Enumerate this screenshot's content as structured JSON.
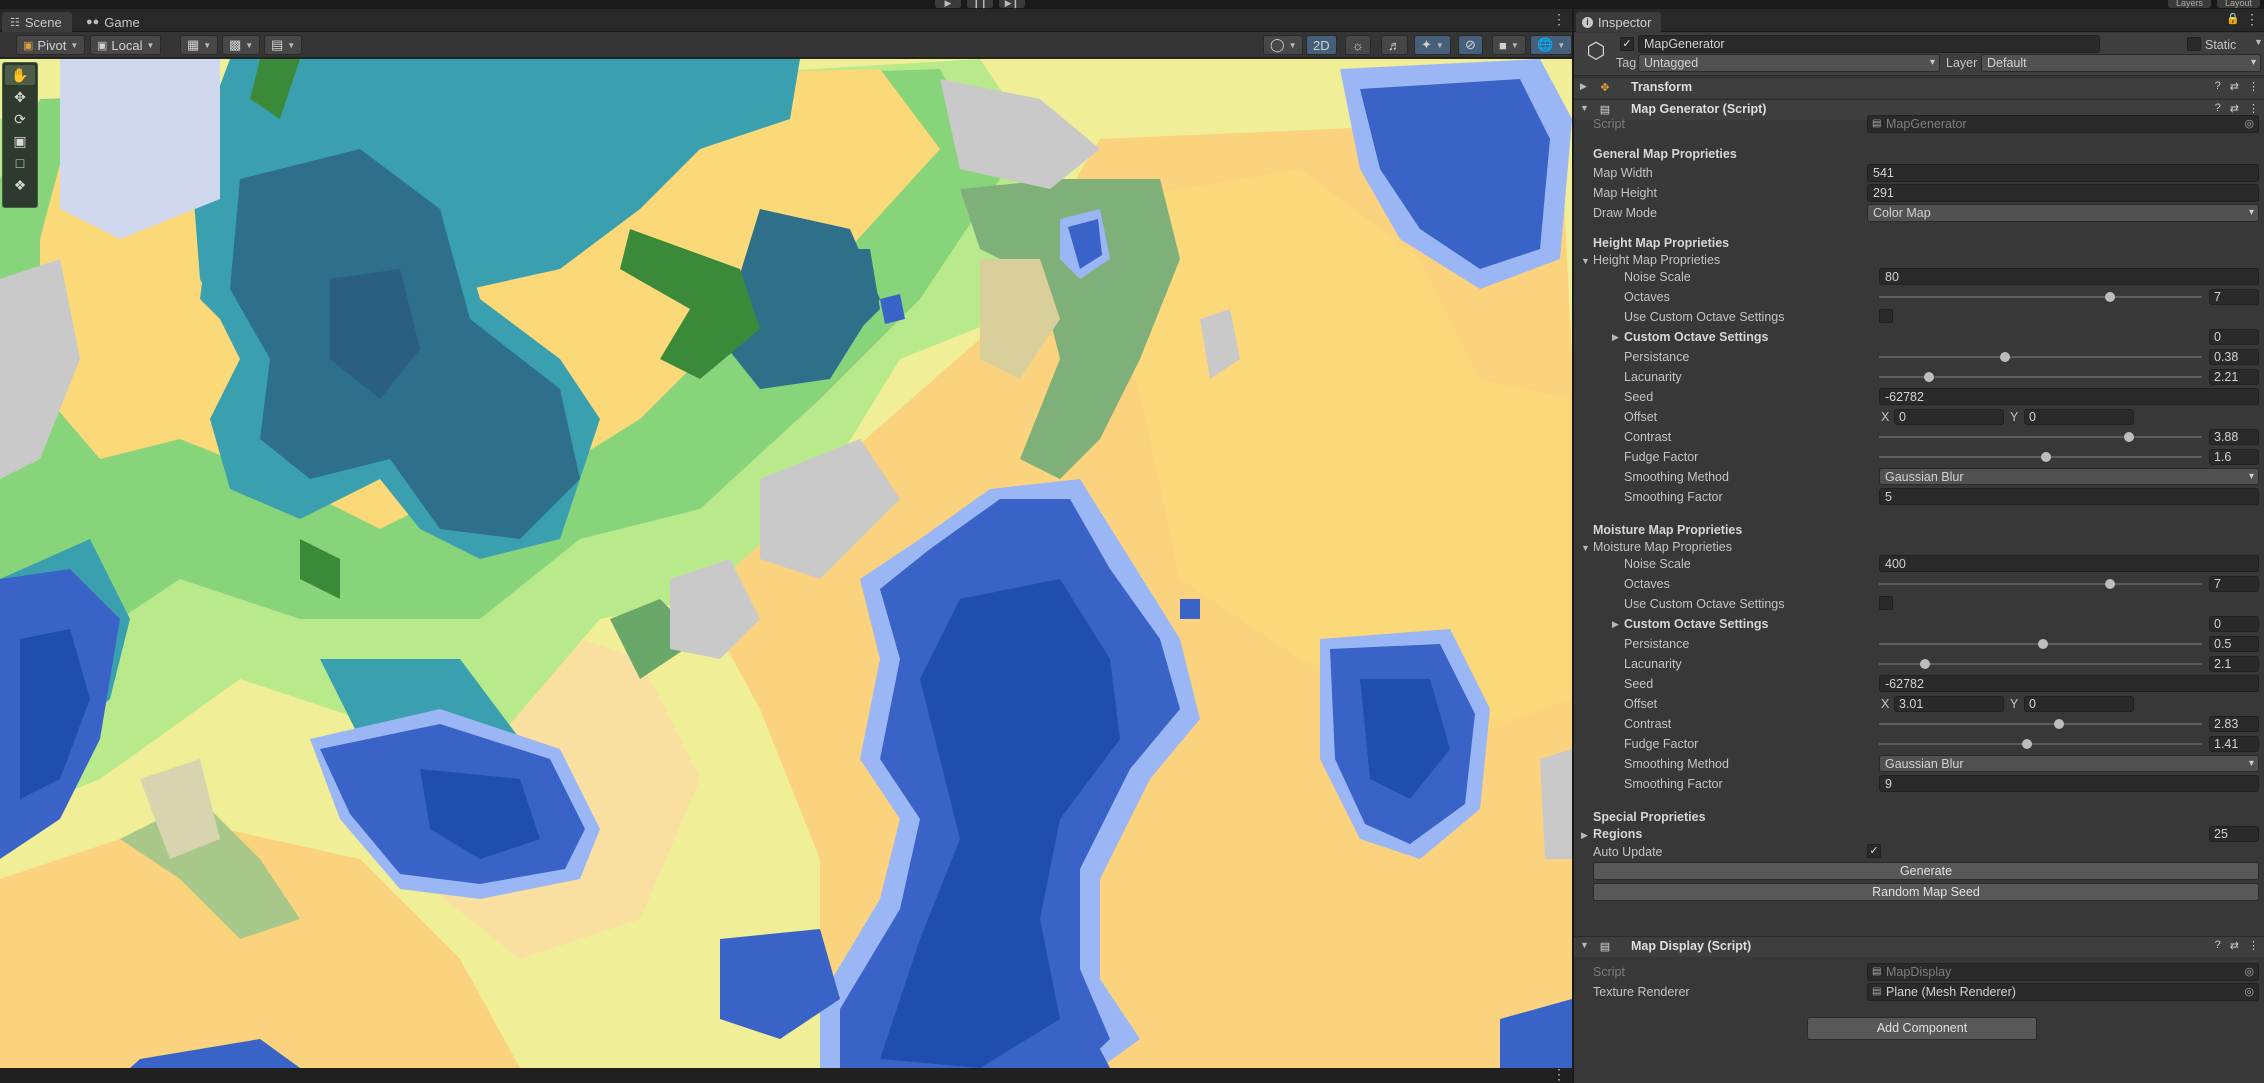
{
  "toolbar": {
    "play_buttons": [
      "▶",
      "❙❙",
      "▶❙"
    ],
    "layers_label": "Layers",
    "layout_label": "Layout"
  },
  "scene": {
    "tabs": [
      {
        "label": "Scene",
        "icon": "grid-icon",
        "active": true
      },
      {
        "label": "Game",
        "icon": "gamepad-icon",
        "active": false
      }
    ],
    "pivot_label": "Pivot",
    "local_label": "Local",
    "mode_2d_label": "2D",
    "tools": [
      "hand-tool",
      "move-tool",
      "rotate-tool",
      "scale-tool",
      "rect-tool",
      "transform-tool"
    ]
  },
  "inspector": {
    "tab_label": "Inspector",
    "object_name": "MapGenerator",
    "active": true,
    "static_label": "Static",
    "tag_label": "Tag",
    "tag_value": "Untagged",
    "layer_label": "Layer",
    "layer_value": "Default",
    "transform_title": "Transform",
    "map_generator": {
      "title": "Map Generator (Script)",
      "script_label": "Script",
      "script_value": "MapGenerator",
      "general_header": "General Map Proprieties",
      "map_width_label": "Map Width",
      "map_width": "541",
      "map_height_label": "Map Height",
      "map_height": "291",
      "draw_mode_label": "Draw Mode",
      "draw_mode": "Color Map",
      "height_header": "Height Map Proprieties",
      "height_fold": "Height Map Proprieties",
      "height": {
        "noise_scale_label": "Noise Scale",
        "noise_scale": "80",
        "octaves_label": "Octaves",
        "octaves": "7",
        "octaves_slider": 0.71,
        "custom_octave_label": "Use Custom Octave Settings",
        "custom_octave": false,
        "custom_octave_settings_label": "Custom Octave Settings",
        "custom_octave_count": "0",
        "persistance_label": "Persistance",
        "persistance": "0.38",
        "persistance_slider": 0.38,
        "lacunarity_label": "Lacunarity",
        "lacunarity": "2.21",
        "lacunarity_slider": 0.14,
        "seed_label": "Seed",
        "seed": "-62782",
        "offset_label": "Offset",
        "offset_x_label": "X",
        "offset_x": "0",
        "offset_y_label": "Y",
        "offset_y": "0",
        "contrast_label": "Contrast",
        "contrast": "3.88",
        "contrast_slider": 0.77,
        "fudge_label": "Fudge Factor",
        "fudge": "1.6",
        "fudge_slider": 0.51,
        "smoothing_method_label": "Smoothing Method",
        "smoothing_method": "Gaussian Blur",
        "smoothing_factor_label": "Smoothing Factor",
        "smoothing_factor": "5"
      },
      "moisture_header": "Moisture Map Proprieties",
      "moisture_fold": "Moisture Map Proprieties",
      "moisture": {
        "noise_scale_label": "Noise Scale",
        "noise_scale": "400",
        "octaves_label": "Octaves",
        "octaves": "7",
        "octaves_slider": 0.71,
        "custom_octave_label": "Use Custom Octave Settings",
        "custom_octave": false,
        "custom_octave_settings_label": "Custom Octave Settings",
        "custom_octave_count": "0",
        "persistance_label": "Persistance",
        "persistance": "0.5",
        "persistance_slider": 0.5,
        "lacunarity_label": "Lacunarity",
        "lacunarity": "2.1",
        "lacunarity_slider": 0.13,
        "seed_label": "Seed",
        "seed": "-62782",
        "offset_label": "Offset",
        "offset_x_label": "X",
        "offset_x": "3.01",
        "offset_y_label": "Y",
        "offset_y": "0",
        "contrast_label": "Contrast",
        "contrast": "2.83",
        "contrast_slider": 0.55,
        "fudge_label": "Fudge Factor",
        "fudge": "1.41",
        "fudge_slider": 0.45,
        "smoothing_method_label": "Smoothing Method",
        "smoothing_method": "Gaussian Blur",
        "smoothing_factor_label": "Smoothing Factor",
        "smoothing_factor": "9"
      },
      "special_header": "Special Proprieties",
      "regions_label": "Regions",
      "regions_count": "25",
      "auto_update_label": "Auto Update",
      "auto_update": true,
      "generate_label": "Generate",
      "random_seed_label": "Random Map Seed"
    },
    "map_display": {
      "title": "Map Display (Script)",
      "script_label": "Script",
      "script_value": "MapDisplay",
      "texture_renderer_label": "Texture Renderer",
      "texture_renderer_value": "Plane (Mesh Renderer)"
    },
    "add_component_label": "Add Component"
  },
  "colors": {
    "deep_water": "#1f4db0",
    "water": "#3a63c8",
    "shallow": "#9ab6f5",
    "sand": "#f0ee96",
    "dry": "#fbd979",
    "orange_sand": "#fbd27e",
    "grass_light": "#b8e98a",
    "grass": "#88d47a",
    "forest": "#3a8a3a",
    "teal": "#3aa0b0",
    "teal_dark": "#2e6f8a",
    "rock": "#c9c9c9",
    "snow": "#cfd8ef"
  }
}
